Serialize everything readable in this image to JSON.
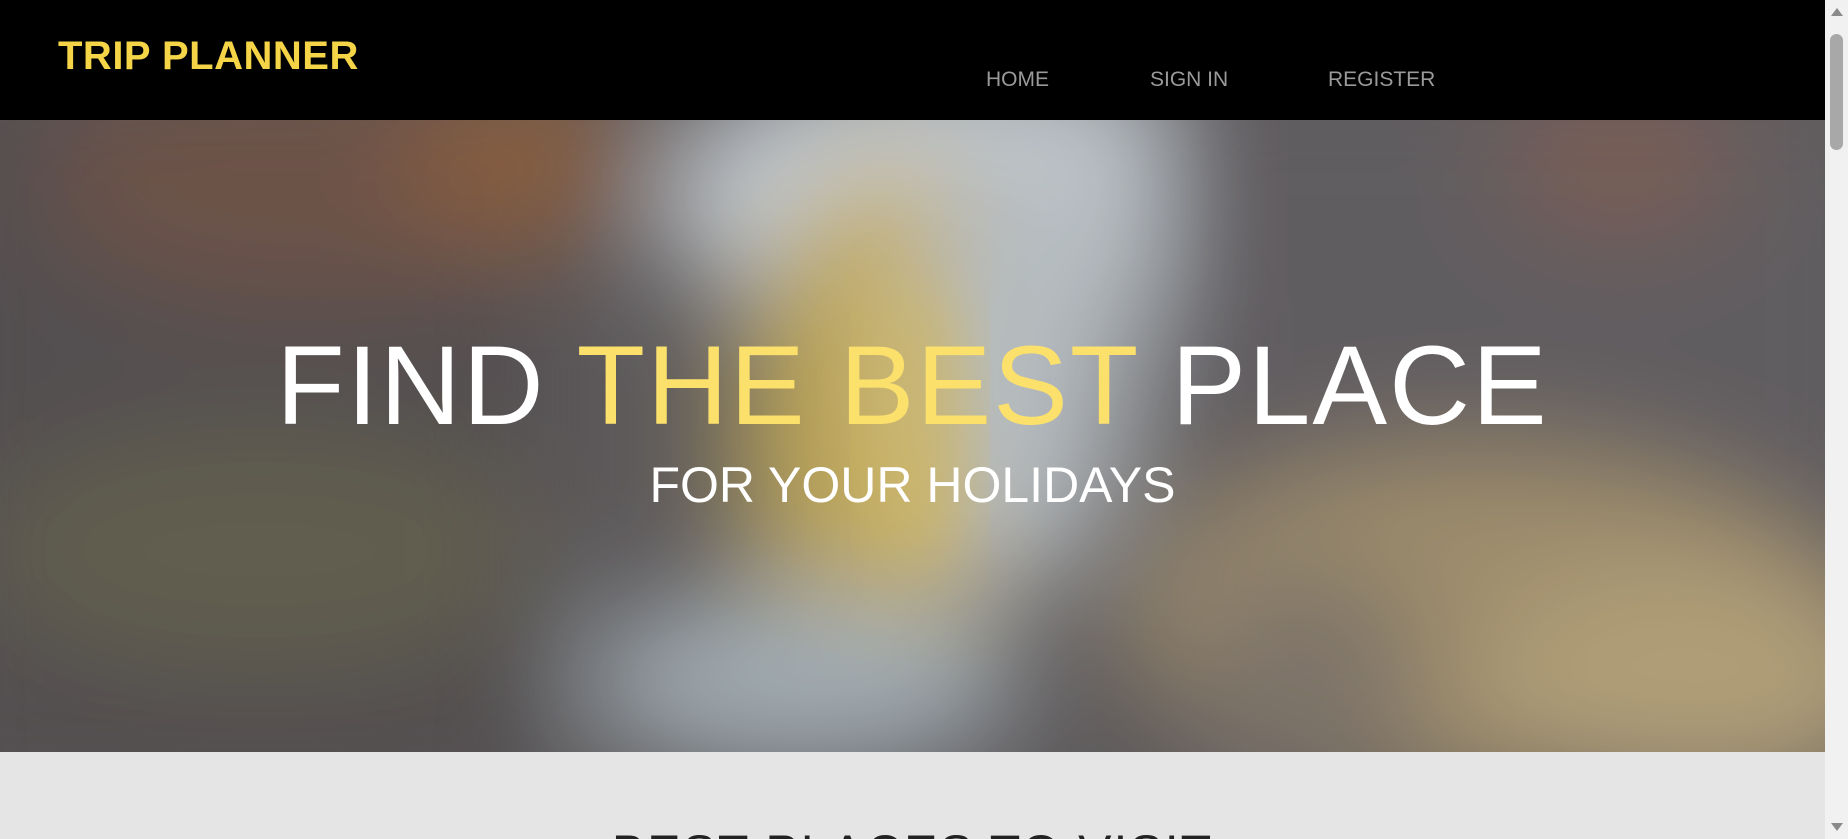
{
  "header": {
    "brand": "TRIP PLANNER",
    "nav": [
      {
        "label": "HOME"
      },
      {
        "label": "SIGN IN"
      },
      {
        "label": "REGISTER"
      }
    ]
  },
  "hero": {
    "title_part1": "FIND ",
    "title_accent": "THE BEST",
    "title_part2": " PLACE",
    "subtitle": "FOR YOUR HOLIDAYS"
  },
  "section": {
    "title": "BEST PLACES TO VISIT"
  },
  "colors": {
    "navbar_bg": "#000000",
    "brand": "#f5d547",
    "nav_link": "#9a9a9a",
    "accent": "#fbe06c",
    "section_bg": "#e5e5e5"
  },
  "icons": {
    "scroll_up": "triangle-up-icon",
    "scroll_down": "triangle-down-icon"
  }
}
